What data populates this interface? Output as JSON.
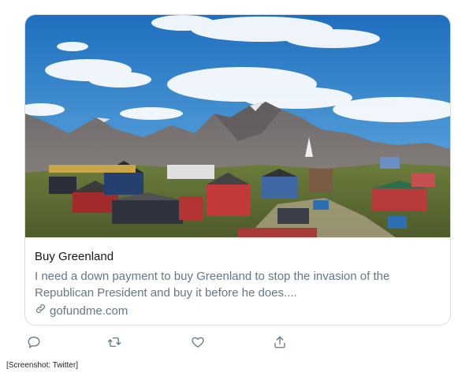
{
  "card": {
    "title": "Buy Greenland",
    "description": "I need a down payment to buy Greenland to stop the invasion of the Republican President and buy it before he does....",
    "domain": "gofundme.com"
  },
  "actions": [
    {
      "icon": "reply-icon"
    },
    {
      "icon": "retweet-icon"
    },
    {
      "icon": "like-icon"
    },
    {
      "icon": "share-icon"
    }
  ],
  "caption": "[Screenshot: Twitter]",
  "colors": {
    "text": "#14171a",
    "muted": "#657786",
    "border": "#d8dee4",
    "sky": "#2f7fc8"
  }
}
